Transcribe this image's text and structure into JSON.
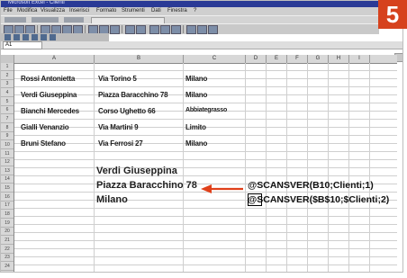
{
  "app": {
    "title": "Microsoft Excel - Clienti"
  },
  "menu": [
    "File",
    "Modifica",
    "Visualizza",
    "Inserisci",
    "Formato",
    "Strumenti",
    "Dati",
    "Finestra",
    "?"
  ],
  "formula_bar": {
    "name_box": "A1"
  },
  "badge": "5",
  "columns": [
    "A",
    "B",
    "C",
    "D",
    "E",
    "F",
    "G",
    "H",
    "I"
  ],
  "rows": [
    "1",
    "2",
    "3",
    "4",
    "5",
    "6",
    "7",
    "8",
    "9",
    "10",
    "11",
    "12",
    "13",
    "14",
    "15",
    "16",
    "17",
    "18",
    "19",
    "20",
    "21",
    "22",
    "23",
    "24"
  ],
  "table": [
    {
      "name": "Rossi Antonietta",
      "address": "Via Torino 5",
      "city": "Milano"
    },
    {
      "name": "Verdi Giuseppina",
      "address": "Piazza Baracchino 78",
      "city": "Milano"
    },
    {
      "name": "Bianchi Mercedes",
      "address": "Corso Ughetto 66",
      "city": "Abbiategrasso"
    },
    {
      "name": "Gialli Venanzio",
      "address": "Via Martini 9",
      "city": "Limito"
    },
    {
      "name": "Bruni Stefano",
      "address": "Via Ferrosi 27",
      "city": "Milano"
    }
  ],
  "result": {
    "name": "Verdi Giuseppina",
    "address": "Piazza Baracchino 78",
    "city": "Milano"
  },
  "formulas": {
    "line1": "@SCANSVER(B10;Clienti;1)",
    "line2": "@SCANSVER($B$10;$Clienti;2)"
  },
  "colors": {
    "badge": "#d6421d",
    "arrow": "#e0401a"
  }
}
